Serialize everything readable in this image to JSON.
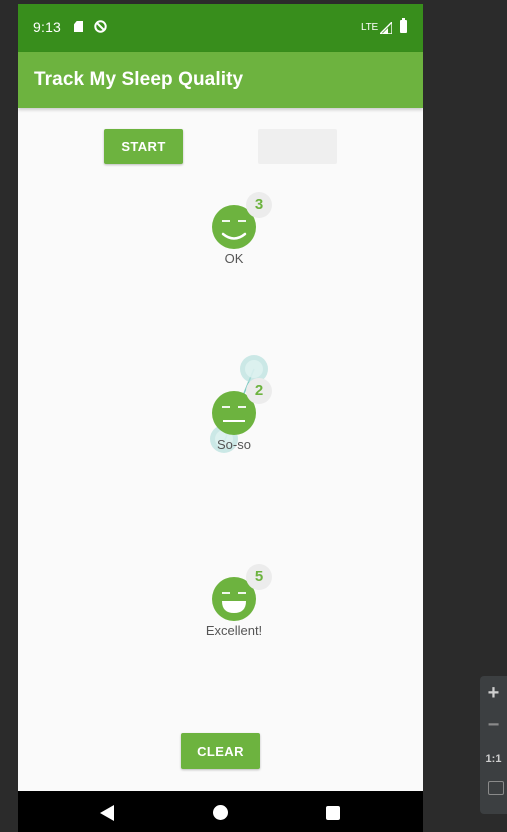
{
  "status_bar": {
    "time": "9:13",
    "network": "LTE",
    "sd_icon": "sd-card-icon",
    "dnd_icon": "do-not-disturb-icon",
    "signal_icon": "signal-icon",
    "battery_icon": "battery-icon"
  },
  "app_bar": {
    "title": "Track My Sleep Quality"
  },
  "controls": {
    "start_label": "START",
    "stop_label": "",
    "clear_label": "CLEAR"
  },
  "nights": [
    {
      "quality": "3",
      "label": "OK",
      "face": "ok-face-icon"
    },
    {
      "quality": "2",
      "label": "So-so",
      "face": "so-so-face-icon"
    },
    {
      "quality": "5",
      "label": "Excellent!",
      "face": "excellent-face-icon"
    }
  ],
  "nav_bar": {
    "back_icon": "back-icon",
    "home_icon": "home-icon",
    "recents_icon": "recents-icon"
  },
  "emulator_panel": {
    "zoom_in": "+",
    "zoom_out": "−",
    "actual_size": "1:1",
    "fit_icon": "fit-screen-icon"
  },
  "colors": {
    "status_bar": "#388e1c",
    "primary": "#6db33f",
    "background": "#fafafa",
    "badge_bg": "#ececec",
    "label_text": "#555555"
  }
}
